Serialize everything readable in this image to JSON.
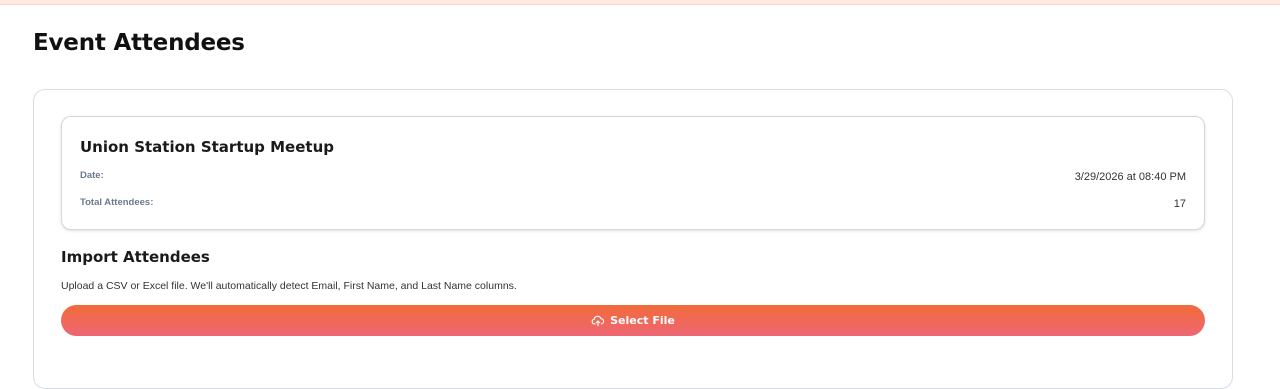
{
  "page": {
    "title": "Event Attendees"
  },
  "event": {
    "name": "Union Station Startup Meetup",
    "date_label": "Date:",
    "date_value": "3/29/2026 at 08:40 PM",
    "attendees_label": "Total Attendees:",
    "attendees_value": "17"
  },
  "import": {
    "title": "Import Attendees",
    "description": "Upload a CSV or Excel file. We'll automatically detect Email, First Name, and Last Name columns.",
    "button_label": "Select File",
    "button_icon": "cloud-upload-icon"
  },
  "colors": {
    "accent_start": "#f26b3a",
    "accent_end": "#ee6674"
  }
}
